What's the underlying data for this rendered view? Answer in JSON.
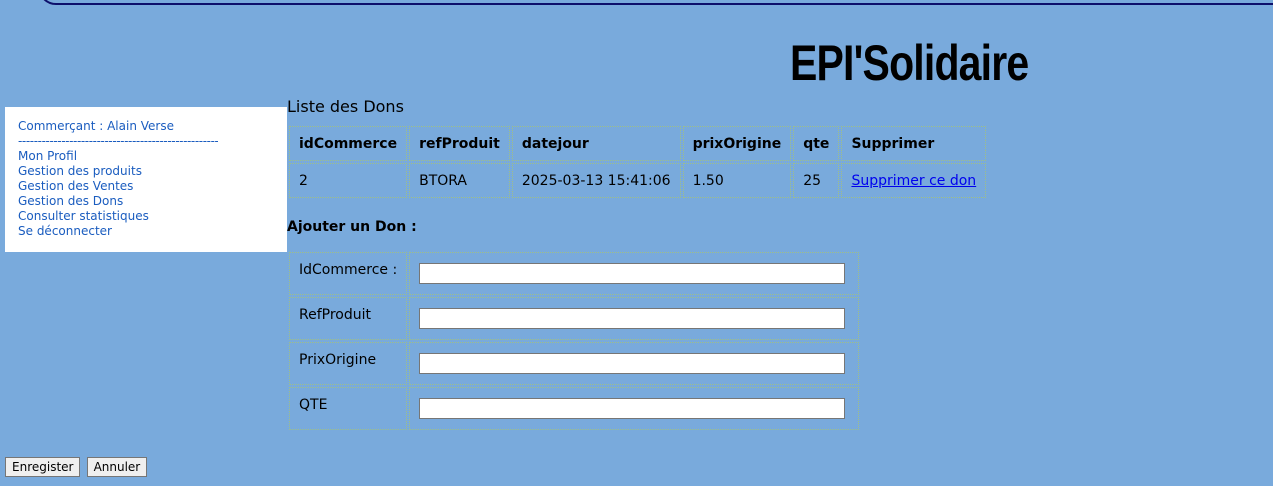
{
  "brand": "EPI'Solidaire",
  "sidebar": {
    "user_line": "Commerçant : Alain Verse",
    "separator": "-------------------------------------------------------",
    "items": [
      {
        "label": "Mon Profil"
      },
      {
        "label": "Gestion des produits"
      },
      {
        "label": "Gestion des Ventes"
      },
      {
        "label": "Gestion des Dons"
      },
      {
        "label": "Consulter statistiques"
      },
      {
        "label": "Se déconnecter"
      }
    ]
  },
  "list": {
    "title": "Liste des Dons",
    "headers": [
      "idCommerce",
      "refProduit",
      "datejour",
      "prixOrigine",
      "qte",
      "Supprimer"
    ],
    "rows": [
      {
        "idCommerce": "2",
        "refProduit": "BTORA",
        "datejour": "2025-03-13 15:41:06",
        "prixOrigine": "1.50",
        "qte": "25",
        "action": "Supprimer ce don"
      }
    ]
  },
  "form": {
    "title": "Ajouter un Don :",
    "fields": [
      {
        "label": "IdCommerce :",
        "value": ""
      },
      {
        "label": "RefProduit",
        "value": ""
      },
      {
        "label": "PrixOrigine",
        "value": ""
      },
      {
        "label": "QTE",
        "value": ""
      }
    ]
  },
  "buttons": {
    "save": "Enregister",
    "cancel": "Annuler"
  }
}
